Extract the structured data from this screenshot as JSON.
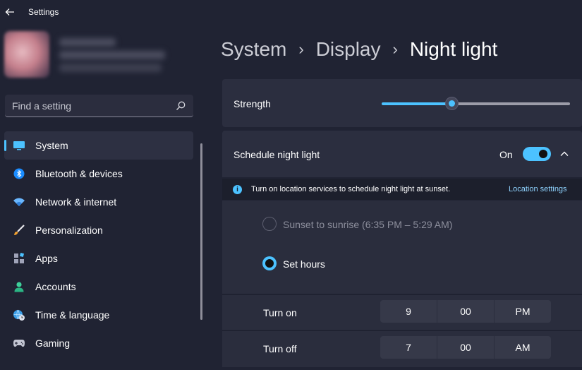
{
  "window": {
    "title": "Settings"
  },
  "search": {
    "placeholder": "Find a setting"
  },
  "sidebar": {
    "items": [
      {
        "label": "System",
        "icon": "display-icon",
        "active": true
      },
      {
        "label": "Bluetooth & devices",
        "icon": "bluetooth-icon"
      },
      {
        "label": "Network & internet",
        "icon": "wifi-icon"
      },
      {
        "label": "Personalization",
        "icon": "brush-icon"
      },
      {
        "label": "Apps",
        "icon": "apps-icon"
      },
      {
        "label": "Accounts",
        "icon": "person-icon"
      },
      {
        "label": "Time & language",
        "icon": "globe-clock-icon"
      },
      {
        "label": "Gaming",
        "icon": "gamepad-icon"
      }
    ]
  },
  "breadcrumb": {
    "items": [
      "System",
      "Display",
      "Night light"
    ]
  },
  "strength": {
    "label": "Strength",
    "value_percent": 37
  },
  "schedule": {
    "label": "Schedule night light",
    "state_label": "On",
    "enabled": true
  },
  "info": {
    "text": "Turn on location services to schedule night light at sunset.",
    "link": "Location settings"
  },
  "options": {
    "sunset_label": "Sunset to sunrise (6:35 PM – 5:29 AM)",
    "set_hours_label": "Set hours",
    "selected": "set_hours"
  },
  "turn_on": {
    "label": "Turn on",
    "hour": "9",
    "minute": "00",
    "ampm": "PM"
  },
  "turn_off": {
    "label": "Turn off",
    "hour": "7",
    "minute": "00",
    "ampm": "AM"
  },
  "colors": {
    "accent": "#4cc2ff",
    "background": "#202333",
    "card": "#2b2e3f"
  }
}
